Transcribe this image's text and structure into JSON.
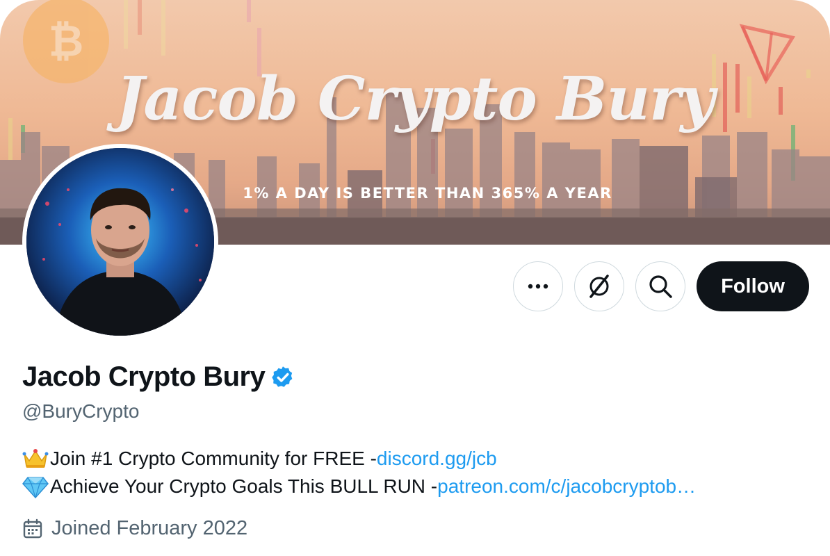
{
  "banner": {
    "title": "Jacob Crypto Bury",
    "tagline": "1% A DAY IS BETTER THAN 365% A YEAR",
    "coin_symbol": "₿"
  },
  "actions": {
    "more_icon": "more-horizontal-icon",
    "grok_icon": "grok-icon",
    "search_icon": "search-icon",
    "follow_label": "Follow"
  },
  "profile": {
    "display_name": "Jacob Crypto Bury",
    "verified_icon": "verified-badge-icon",
    "handle": "@BuryCrypto",
    "bio": {
      "line1_text": "Join #1 Crypto Community for FREE - ",
      "line1_link": "discord.gg/jcb",
      "line1_emoji": "crown-icon",
      "line2_text": "Achieve Your Crypto Goals This BULL RUN  - ",
      "line2_link": "patreon.com/c/jacobcryptob…",
      "line2_emoji": "gem-icon"
    },
    "joined": "Joined February 2022",
    "joined_icon": "calendar-icon"
  },
  "colors": {
    "accent": "#1d9bf0",
    "text": "#0f1419",
    "secondary": "#536471",
    "border": "#cfd9de"
  }
}
